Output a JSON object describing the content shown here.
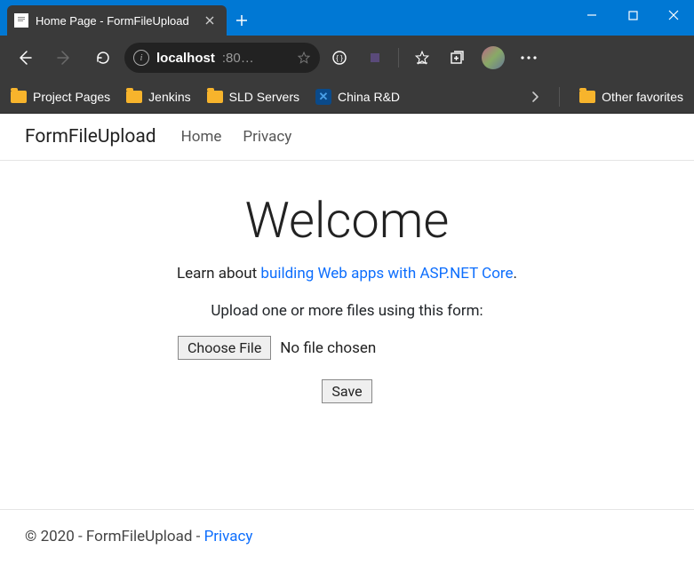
{
  "window": {
    "tab_title": "Home Page - FormFileUpload"
  },
  "address_bar": {
    "host": "localhost",
    "rest": ":80…"
  },
  "bookmarks": {
    "items": [
      {
        "label": "Project Pages"
      },
      {
        "label": "Jenkins"
      },
      {
        "label": "SLD Servers"
      },
      {
        "label": "China R&D"
      }
    ],
    "other": "Other favorites"
  },
  "site": {
    "brand": "FormFileUpload",
    "nav": [
      {
        "label": "Home"
      },
      {
        "label": "Privacy"
      }
    ],
    "heading": "Welcome",
    "lede_prefix": "Learn about ",
    "lede_link": "building Web apps with ASP.NET Core",
    "lede_suffix": ".",
    "instructions": "Upload one or more files using this form:",
    "choose_label": "Choose File",
    "no_file_text": "No file chosen",
    "save_label": "Save",
    "footer_text": "© 2020 - FormFileUpload - ",
    "footer_link": "Privacy"
  }
}
